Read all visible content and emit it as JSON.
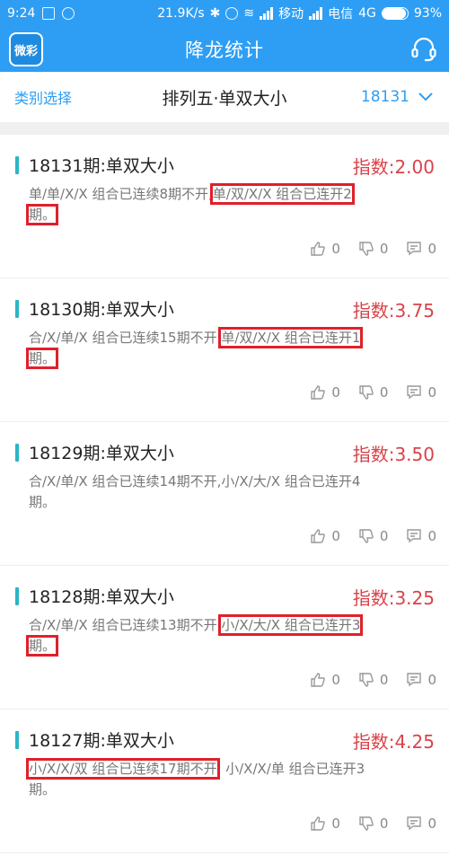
{
  "status": {
    "time": "9:24",
    "speed": "21.9K/s",
    "carrier1": "移动",
    "carrier2": "电信",
    "network": "4G",
    "battery": "93%",
    "battery_level": 0.93
  },
  "header": {
    "logo_text": "微彩",
    "title": "降龙统计"
  },
  "subheader": {
    "category_label": "类别选择",
    "page_title": "排列五·单双大小",
    "issue_value": "18131"
  },
  "items": [
    {
      "name": "18131期:单双大小",
      "index": "指数:2.00",
      "desc_a": "单/单/X/X 组合已连续8期不开,",
      "desc_b": "单/双/X/X 组合已连开2",
      "desc_c": "期。",
      "likes": "0",
      "dislikes": "0",
      "comments": "0"
    },
    {
      "name": "18130期:单双大小",
      "index": "指数:3.75",
      "desc_a": "合/X/单/X 组合已连续15期不开,",
      "desc_b": "单/双/X/X 组合已连开1",
      "desc_c": "期。",
      "likes": "0",
      "dislikes": "0",
      "comments": "0"
    },
    {
      "name": "18129期:单双大小",
      "index": "指数:3.50",
      "desc_a": "合/X/单/X 组合已连续14期不开,",
      "desc_b": "小/X/大/X 组合已连开4",
      "desc_c": "期。",
      "likes": "0",
      "dislikes": "0",
      "comments": "0"
    },
    {
      "name": "18128期:单双大小",
      "index": "指数:3.25",
      "desc_a": "合/X/单/X 组合已连续13期不开,",
      "desc_b": "小/X/大/X 组合已连开3",
      "desc_c": "期。",
      "likes": "0",
      "dislikes": "0",
      "comments": "0"
    },
    {
      "name": "18127期:单双大小",
      "index": "指数:4.25",
      "desc_a": "小/X/X/双 组合已连续17期不开",
      "desc_b": ", 小/X/X/单 组合已连开3",
      "desc_c": "期。",
      "likes": "0",
      "dislikes": "0",
      "comments": "0"
    }
  ],
  "icons": {
    "like": "thumb-up-icon",
    "dislike": "thumb-down-icon",
    "comment": "comment-icon",
    "support": "headset-icon",
    "dropdown": "chevron-down-icon"
  }
}
